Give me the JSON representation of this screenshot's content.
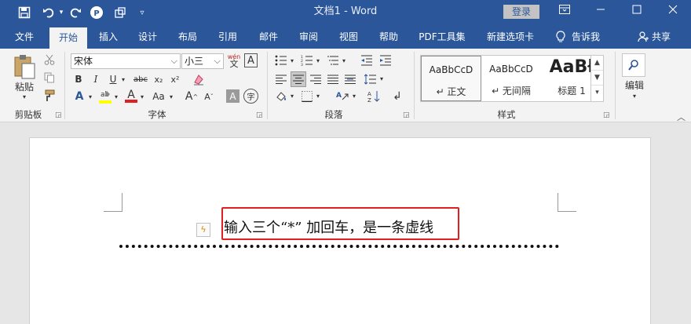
{
  "title_bar": {
    "doc_title": "文档1 - Word",
    "login_label": "登录",
    "quick_access": [
      "save-icon",
      "undo-icon",
      "redo-icon",
      "pdf-icon",
      "touch-mode-icon",
      "customize-icon"
    ],
    "window_buttons": [
      "ribbon-display-icon",
      "minimize-icon",
      "restore-icon",
      "close-icon"
    ]
  },
  "tabs": [
    "文件",
    "开始",
    "插入",
    "设计",
    "布局",
    "引用",
    "邮件",
    "审阅",
    "视图",
    "帮助",
    "PDF工具集",
    "新建选项卡"
  ],
  "tell_me": "告诉我",
  "share": "共享",
  "ribbon": {
    "clipboard": {
      "paste_label": "粘贴",
      "group_label": "剪贴板"
    },
    "font": {
      "font_name": "宋体",
      "font_size": "小三",
      "phonetic_glyph": "wén",
      "border_glyph": "A",
      "bold": "B",
      "italic": "I",
      "underline": "U",
      "strike": "abc",
      "subscript": "x₂",
      "superscript": "x²",
      "font_color_glyph": "A",
      "case_glyph": "Aa",
      "grow_glyph": "A",
      "shrink_glyph": "A",
      "shade_glyph": "A",
      "enclose_glyph": "字",
      "group_label": "字体"
    },
    "paragraph": {
      "group_label": "段落"
    },
    "styles": {
      "items": [
        {
          "preview": "AaBbCcD",
          "name": "↵ 正文"
        },
        {
          "preview": "AaBbCcD",
          "name": "↵ 无间隔"
        },
        {
          "preview": "AaBł",
          "name": "标题 1"
        }
      ],
      "group_label": "样式"
    },
    "editing": {
      "label": "编辑"
    }
  },
  "document": {
    "line_text": "输入三个“*” 加回车，是一条虚线"
  },
  "colors": {
    "brand": "#2b579a",
    "highlight_border": "#e02020",
    "highlighter_yellow": "#ffff00",
    "font_red": "#e02020"
  }
}
